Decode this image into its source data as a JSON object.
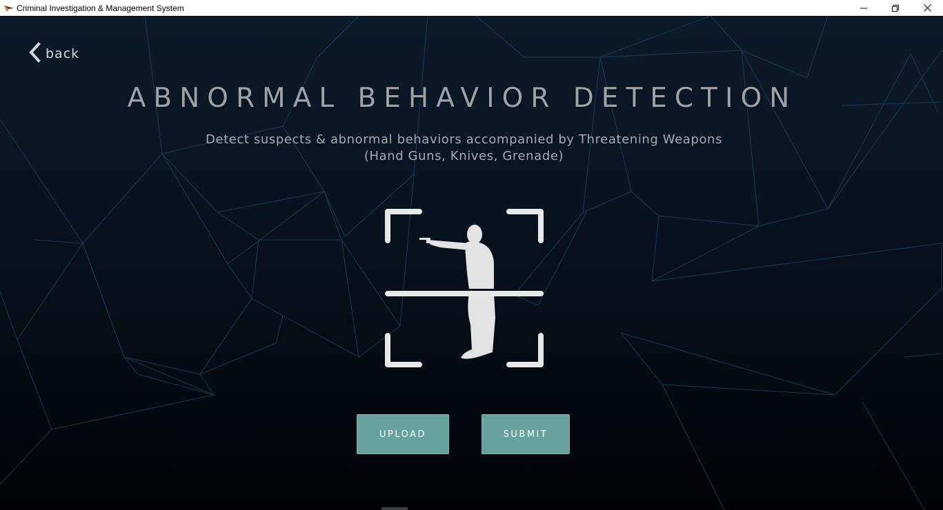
{
  "window": {
    "title": "Criminal Investigation & Management System",
    "app_icon": "app-logo-icon",
    "controls": [
      "minimize-icon",
      "restore-icon",
      "close-icon"
    ]
  },
  "nav": {
    "back_label": "back",
    "back_icon": "chevron-left-icon"
  },
  "header": {
    "title": "ABNORMAL BEHAVIOR DETECTION",
    "subtitle_line1": "Detect suspects & abnormal behaviors accompanied by Threatening Weapons",
    "subtitle_line2": "(Hand Guns, Knives, Grenade)"
  },
  "graphic": {
    "icon": "gunman-scan-icon"
  },
  "actions": {
    "upload_label": "UPLOAD",
    "submit_label": "SUBMIT"
  },
  "colors": {
    "background_top": "#0b1a2a",
    "background_bottom": "#020306",
    "network_lines": "#1b4a66",
    "button_bg": "#66a19e",
    "title_text": "#9fa3a8",
    "icon_fill": "#e8e8e8"
  }
}
